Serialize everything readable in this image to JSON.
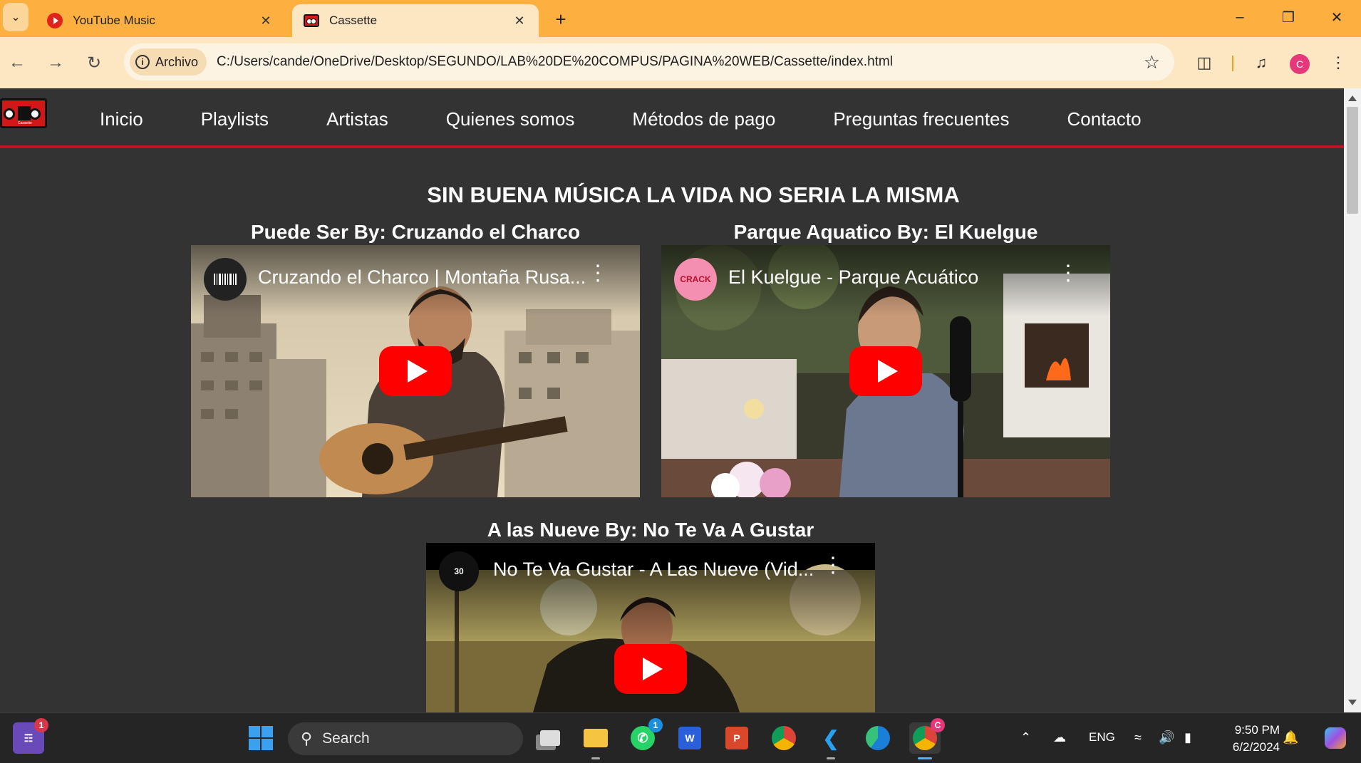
{
  "browser": {
    "tabs": [
      {
        "title": "YouTube Music",
        "active": false
      },
      {
        "title": "Cassette",
        "active": true
      }
    ],
    "address": {
      "chip_label": "Archivo",
      "url": "C:/Users/cande/OneDrive/Desktop/SEGUNDO/LAB%20DE%20COMPUS/PAGINA%20WEB/Cassette/index.html"
    },
    "profile_initial": "C"
  },
  "site": {
    "logo_text": "Cassette",
    "nav": [
      "Inicio",
      "Playlists",
      "Artistas",
      "Quienes somos",
      "Métodos de pago",
      "Preguntas frecuentes",
      "Contacto"
    ],
    "headline": "SIN BUENA MÚSICA LA VIDA NO SERIA LA MISMA",
    "videos": [
      {
        "heading": "Puede Ser By: Cruzando el Charco",
        "yt_title": "Cruzando el Charco | Montaña Rusa...",
        "channel": "barcode",
        "channel_color": "#222222"
      },
      {
        "heading": "Parque Aquatico By: El Kuelgue",
        "yt_title": "El Kuelgue - Parque Acuático",
        "channel": "CRACK",
        "channel_color": "#f48fb1"
      },
      {
        "heading": "A las Nueve By: No Te Va A Gustar",
        "yt_title": "No Te Va Gustar - A Las Nueve (Vid...",
        "channel": "30",
        "channel_color": "#111111"
      }
    ]
  },
  "taskbar": {
    "search_label": "Search",
    "language": "ENG",
    "time": "9:50 PM",
    "date": "6/2/2024",
    "badges": {
      "teams": "1",
      "whatsapp": "1",
      "chrome": "C"
    }
  },
  "colors": {
    "tab_strip": "#fdb03f",
    "toolbar": "#fde6c2",
    "page_bg": "#333333",
    "nav_underline": "#c1121f",
    "play_button": "#ff0000"
  }
}
